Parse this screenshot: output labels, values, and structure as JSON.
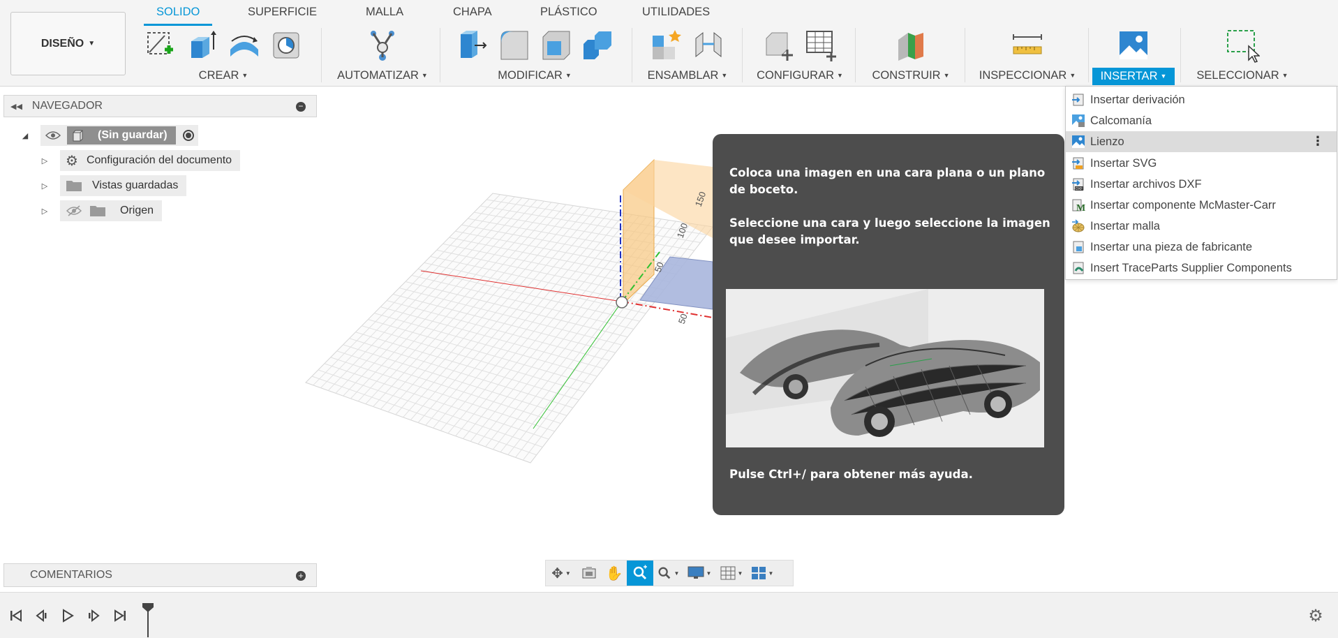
{
  "workspace": {
    "label": "DISEÑO"
  },
  "tabs": [
    {
      "label": "SOLIDO",
      "active": true
    },
    {
      "label": "SUPERFICIE"
    },
    {
      "label": "MALLA"
    },
    {
      "label": "CHAPA"
    },
    {
      "label": "PLÁSTICO"
    },
    {
      "label": "UTILIDADES"
    }
  ],
  "groups": {
    "crear": "CREAR",
    "automatizar": "AUTOMATIZAR",
    "modificar": "MODIFICAR",
    "ensamblar": "ENSAMBLAR",
    "configurar": "CONFIGURAR",
    "construir": "CONSTRUIR",
    "inspeccionar": "INSPECCIONAR",
    "insertar": "INSERTAR",
    "seleccionar": "SELECCIONAR"
  },
  "navigator": {
    "title": "NAVEGADOR",
    "root": "(Sin guardar)",
    "items": [
      {
        "label": "Configuración del documento",
        "icon": "gear-icon"
      },
      {
        "label": "Vistas guardadas",
        "icon": "folder-icon"
      },
      {
        "label": "Origen",
        "icon": "folder-icon"
      }
    ]
  },
  "viewport": {
    "axis_labels": [
      "150",
      "100",
      "50",
      "50"
    ]
  },
  "tooltip": {
    "line1": "Coloca una imagen en una cara plana o un plano de boceto.",
    "line2": "Seleccione una cara y luego seleccione la imagen que desee importar.",
    "footer": "Pulse Ctrl+/ para obtener más ayuda."
  },
  "insert_menu": [
    {
      "label": "Insertar derivación",
      "icon": "derive-icon"
    },
    {
      "label": "Calcomanía",
      "icon": "decal-icon"
    },
    {
      "label": "Lienzo",
      "icon": "canvas-icon",
      "highlighted": true
    },
    {
      "label": "Insertar SVG",
      "icon": "svg-icon"
    },
    {
      "label": "Insertar archivos DXF",
      "icon": "dxf-icon"
    },
    {
      "label": "Insertar componente McMaster-Carr",
      "icon": "mcmaster-icon"
    },
    {
      "label": "Insertar malla",
      "icon": "mesh-icon"
    },
    {
      "label": "Insertar una pieza de fabricante",
      "icon": "manufacturer-part-icon"
    },
    {
      "label": "Insert TraceParts Supplier Components",
      "icon": "traceparts-icon"
    }
  ],
  "comments": {
    "title": "COMENTARIOS"
  },
  "colors": {
    "accent": "#0696d7",
    "tooltip_bg": "#4d4d4d",
    "highlight": "#dcdcdc"
  }
}
